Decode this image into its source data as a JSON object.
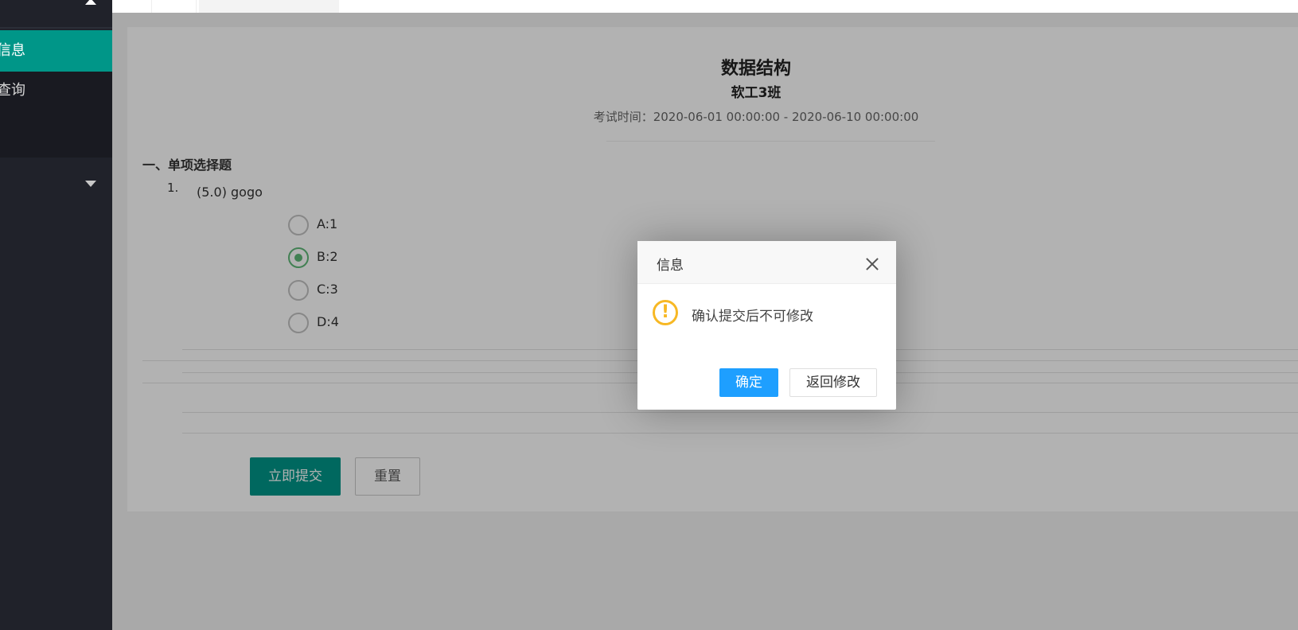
{
  "sidebar": {
    "items": [
      {
        "label": "信息",
        "active": true
      },
      {
        "label": "查询",
        "active": false
      }
    ],
    "caret_icon": "caret-down-icon",
    "top_arrow_icon": "caret-up-icon"
  },
  "exam": {
    "title": "数据结构",
    "class_name": "软工3班",
    "time_label": "考试时间：",
    "time_range": "2020-06-01 00:00:00 - 2020-06-10 00:00:00"
  },
  "section": {
    "title": "一、单项选择题"
  },
  "question": {
    "number": "1.",
    "text": "(5.0) gogo",
    "options": [
      {
        "label": "A:1",
        "checked": false
      },
      {
        "label": "B:2",
        "checked": true
      },
      {
        "label": "C:3",
        "checked": false
      },
      {
        "label": "D:4",
        "checked": false
      }
    ]
  },
  "form": {
    "submit_label": "立即提交",
    "reset_label": "重置"
  },
  "dialog": {
    "title": "信息",
    "message": "确认提交后不可修改",
    "icon": "warning-icon",
    "icon_glyph": "!",
    "ok_label": "确定",
    "back_label": "返回修改"
  },
  "colors": {
    "primary": "#009688",
    "dialog_ok": "#1e9fff",
    "radio_checked": "#5fb878",
    "warning": "#f7b824",
    "sidebar_bg": "#20222a"
  }
}
